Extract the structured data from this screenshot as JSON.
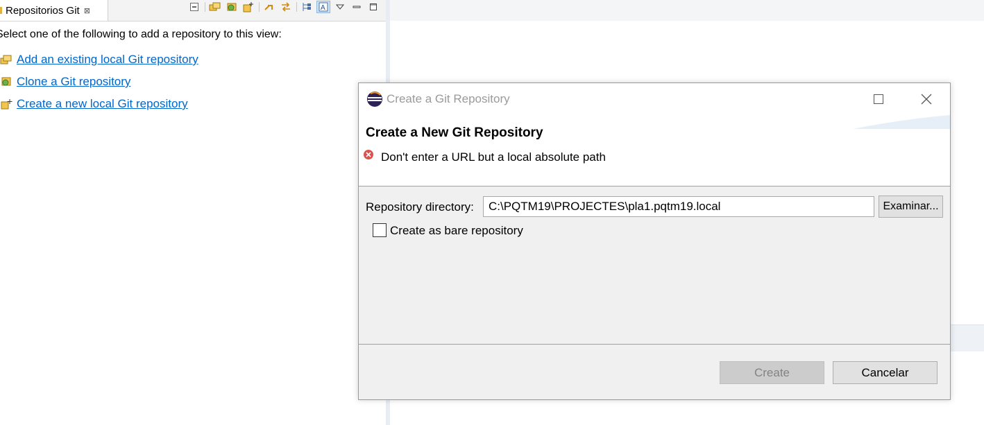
{
  "view": {
    "tab_label": "Repositorios Git",
    "tab_close": "⊠",
    "intro": "Select one of the following to add a repository to this view:",
    "links": [
      {
        "label": "Add an existing local Git repository",
        "icon": "add-repository-icon"
      },
      {
        "label": "Clone a Git repository",
        "icon": "clone-repository-icon"
      },
      {
        "label": "Create a new local Git repository",
        "icon": "create-repository-icon"
      }
    ],
    "toolbar_icons": [
      "collapse-all-icon",
      "add-repository-icon",
      "clone-repository-icon",
      "create-repository-icon",
      "link-editor-icon",
      "refresh-icon",
      "hierarchical-icon",
      "show-label-icon",
      "view-menu-icon",
      "minimize-icon",
      "maximize-icon"
    ]
  },
  "dialog": {
    "title": "Create a Git Repository",
    "header_title": "Create a New Git Repository",
    "error_message": "Don't enter a URL but a local absolute path",
    "repo_dir_label": "Repository directory:",
    "repo_dir_value": "C:\\PQTM19\\PROJECTES\\pla1.pqtm19.local",
    "browse_label": "Examinar...",
    "bare_label": "Create as bare repository",
    "bare_checked": false,
    "create_label": "Create",
    "cancel_label": "Cancelar"
  },
  "colors": {
    "link": "#0066cc",
    "error": "#d9534f",
    "disabled_text": "#838383"
  }
}
